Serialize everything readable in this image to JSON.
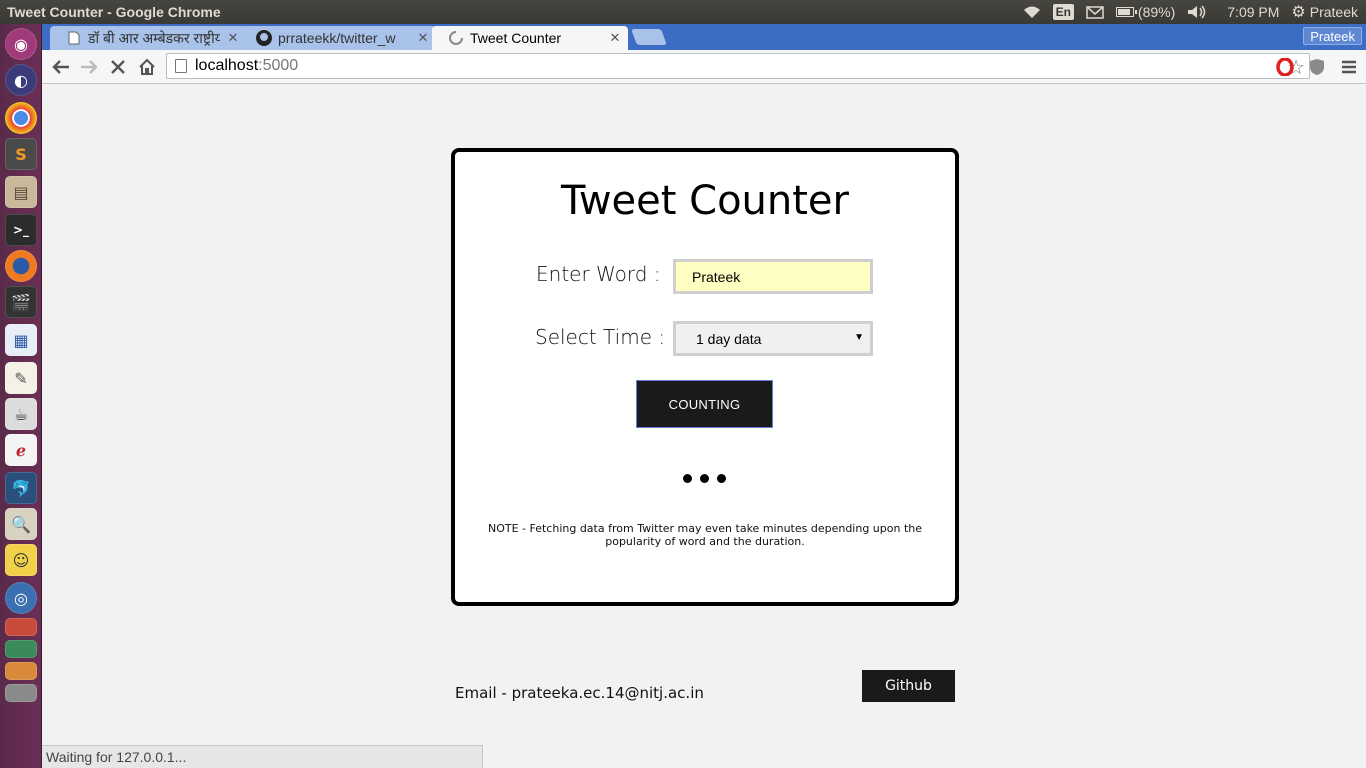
{
  "window": {
    "title": "Tweet Counter - Google Chrome"
  },
  "system_tray": {
    "keyboard": "En",
    "battery": "(89%)",
    "time": "7:09 PM",
    "user": "Prateek"
  },
  "launcher": {
    "icons": [
      "ubuntu-dash-icon",
      "eclipse-icon",
      "chrome-icon",
      "sublime-text-icon",
      "files-icon",
      "terminal-icon",
      "firefox-icon",
      "video-editor-icon",
      "libreoffice-writer-icon",
      "text-editor-icon",
      "java-icon",
      "document-viewer-icon",
      "mysql-workbench-icon",
      "image-viewer-icon",
      "game-icon",
      "browser-icon",
      "app-icon-1",
      "app-icon-2",
      "app-icon-3",
      "app-icon-4"
    ]
  },
  "tabs": [
    {
      "label": "डॉ बी आर अम्बेडकर राष्ट्रीय",
      "favicon": "page-icon"
    },
    {
      "label": "prrateekk/twitter_w",
      "favicon": "github-icon"
    },
    {
      "label": "Tweet Counter",
      "favicon": "loading-icon",
      "active": true
    }
  ],
  "profile_button": "Prateek",
  "address_bar": {
    "host": "localhost",
    "port": ":5000"
  },
  "app": {
    "title": "Tweet Counter",
    "word_label": "Enter Word :",
    "word_value": "Prateek",
    "time_label": "Select Time :",
    "time_selected": "1 day data",
    "button_label": "COUNTING",
    "note": "NOTE - Fetching data from Twitter may even take minutes depending upon the popularity of word and the duration."
  },
  "footer": {
    "email": "Email - prateeka.ec.14@nitj.ac.in",
    "github_label": "Github"
  },
  "status": "Waiting for 127.0.0.1..."
}
